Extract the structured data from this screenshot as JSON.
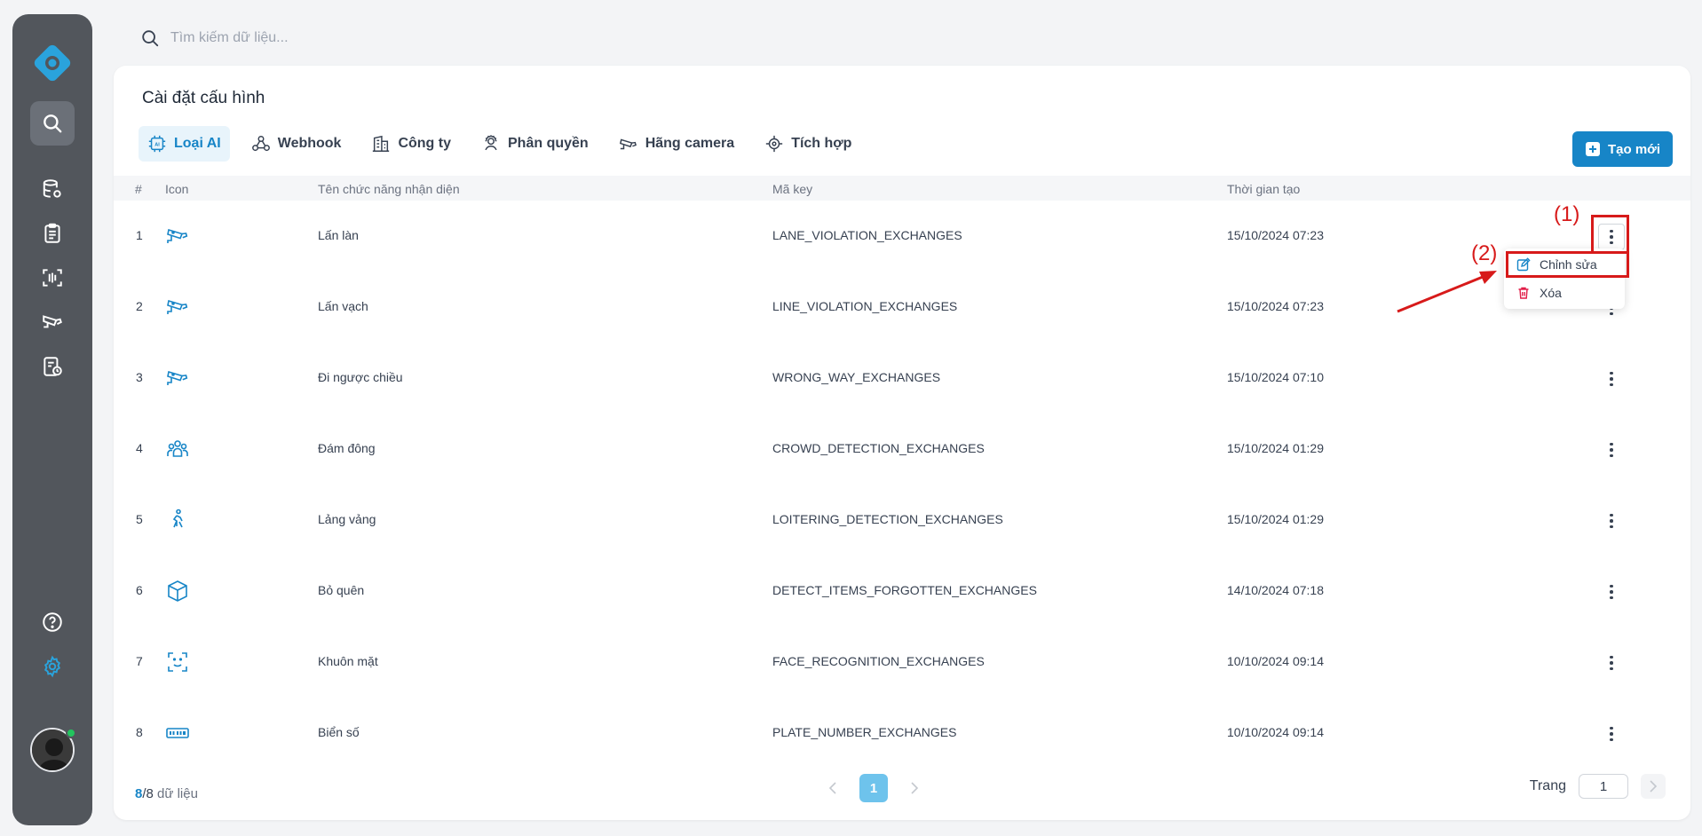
{
  "search": {
    "placeholder": "Tìm kiếm dữ liệu..."
  },
  "page": {
    "title": "Cài đặt cấu hình",
    "create_label": "Tạo mới"
  },
  "tabs": [
    {
      "label": "Loại AI",
      "icon": "ai-chip-icon",
      "active": true
    },
    {
      "label": "Webhook",
      "icon": "webhook-icon"
    },
    {
      "label": "Công ty",
      "icon": "building-icon"
    },
    {
      "label": "Phân quyền",
      "icon": "user-shield-icon"
    },
    {
      "label": "Hãng camera",
      "icon": "camera-icon"
    },
    {
      "label": "Tích hợp",
      "icon": "integration-icon"
    }
  ],
  "table": {
    "headers": [
      "#",
      "Icon",
      "Tên chức năng nhận diện",
      "Mã key",
      "Thời gian tạo"
    ],
    "rows": [
      {
        "no": "1",
        "icon": "cctv-camera-icon",
        "name": "Lấn làn",
        "key": "LANE_VIOLATION_EXCHANGES",
        "time": "15/10/2024 07:23"
      },
      {
        "no": "2",
        "icon": "cctv-camera-icon",
        "name": "Lấn vạch",
        "key": "LINE_VIOLATION_EXCHANGES",
        "time": "15/10/2024 07:23"
      },
      {
        "no": "3",
        "icon": "cctv-camera-icon",
        "name": "Đi ngược chiều",
        "key": "WRONG_WAY_EXCHANGES",
        "time": "15/10/2024 07:10"
      },
      {
        "no": "4",
        "icon": "crowd-icon",
        "name": "Đám đông",
        "key": "CROWD_DETECTION_EXCHANGES",
        "time": "15/10/2024 01:29"
      },
      {
        "no": "5",
        "icon": "walking-person-icon",
        "name": "Lảng vảng",
        "key": "LOITERING_DETECTION_EXCHANGES",
        "time": "15/10/2024 01:29"
      },
      {
        "no": "6",
        "icon": "box-icon",
        "name": "Bỏ quên",
        "key": "DETECT_ITEMS_FORGOTTEN_EXCHANGES",
        "time": "14/10/2024 07:18"
      },
      {
        "no": "7",
        "icon": "face-scan-icon",
        "name": "Khuôn mặt",
        "key": "FACE_RECOGNITION_EXCHANGES",
        "time": "10/10/2024 09:14"
      },
      {
        "no": "8",
        "icon": "license-plate-icon",
        "name": "Biển số",
        "key": "PLATE_NUMBER_EXCHANGES",
        "time": "10/10/2024 09:14"
      }
    ]
  },
  "menu": {
    "edit_label": "Chỉnh sửa",
    "delete_label": "Xóa"
  },
  "annotations": {
    "label1": "(1)",
    "label2": "(2)"
  },
  "footer": {
    "count_shown": "8",
    "count_total": "/8",
    "count_suffix": " dữ liệu",
    "current_page": "1",
    "goto_label": "Trang",
    "goto_value": "1"
  },
  "colors": {
    "accent": "#1785c7",
    "sidebar": "#52565c",
    "annotation": "#d71a1a",
    "danger": "#e11d48"
  }
}
